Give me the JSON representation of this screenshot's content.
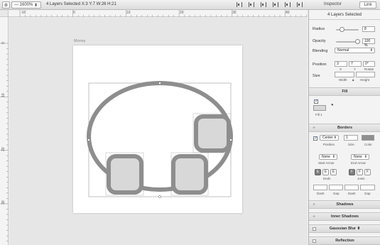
{
  "toolbar": {
    "zoom": "1600%",
    "zoom_minus": "—",
    "zoom_arrow": "⬍",
    "selection_info": "4 Layers Selected   X:3   Y:7   W:26   H:21",
    "inspector_tab": "Inspector",
    "link_tab": "Link"
  },
  "ruler": {
    "top_labels": [
      "-10",
      "0",
      "10",
      "20",
      "30",
      "40"
    ],
    "left_labels": [
      "0",
      "10",
      "20",
      "30"
    ]
  },
  "canvas": {
    "artboard_name": "Money",
    "shape_fill": "#d8d8d8",
    "shape_stroke": "#8e8e8e"
  },
  "inspector": {
    "title": "4 Layers Selected",
    "radius_label": "Radius",
    "radius_value": "8",
    "opacity_label": "Opacity",
    "opacity_value": "100 %",
    "blending_label": "Blending",
    "blending_value": "Normal",
    "position_label": "Position",
    "pos_x": "3",
    "pos_y": "7",
    "rotate": "0°",
    "x_label": "X",
    "y_label": "Y",
    "rotate_label": "Rotate",
    "size_label": "Size",
    "width_label": "Width",
    "height_label": "Height",
    "fill_section": "Fill",
    "fill_item": "Fill 1",
    "borders_section": "Borders",
    "border_position": "Center",
    "border_size": "1",
    "position_sub": "Position",
    "size_sub": "Size",
    "color_sub": "Color",
    "start_arrow": "None",
    "end_arrow": "None",
    "start_arrow_label": "Start Arrow",
    "end_arrow_label": "End Arrow",
    "ends_label": "Ends",
    "joins_label": "Joins",
    "dash_label": "Dash",
    "gap_label": "Gap",
    "shadows_section": "Shadows",
    "inner_shadows_section": "Inner Shadows",
    "gaussian_blur_section": "Gaussian Blur",
    "reflection_section": "Reflection"
  }
}
